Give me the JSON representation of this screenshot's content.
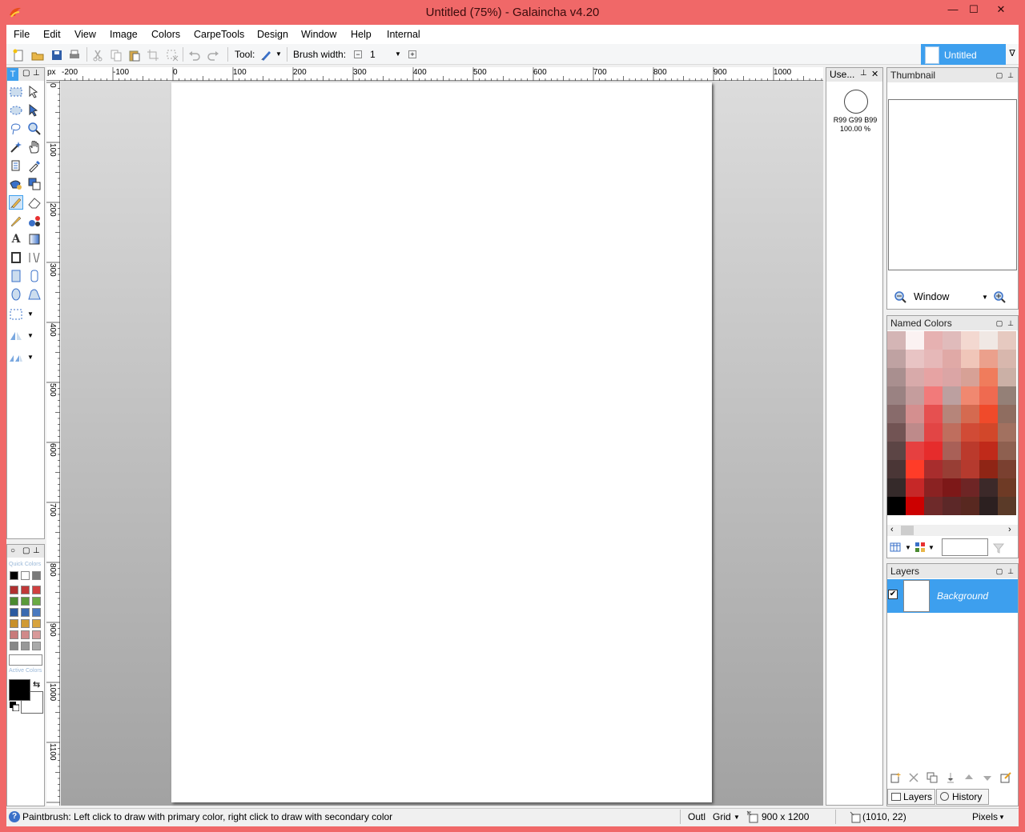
{
  "window": {
    "title": "Untitled (75%) - Galaincha v4.20",
    "minimize": "—",
    "maximize": "☐",
    "close": "✕"
  },
  "menubar": {
    "items": [
      "File",
      "Edit",
      "View",
      "Image",
      "Colors",
      "CarpeTools",
      "Design",
      "Window",
      "Help",
      "Internal"
    ]
  },
  "toolbar": {
    "tool_label": "Tool:",
    "brush_label": "Brush width:",
    "brush_value": "1",
    "minus": "−",
    "plus": "+"
  },
  "document_tab": {
    "label": "Untitled",
    "dropdown": "∇"
  },
  "toolbox": {
    "header": "T"
  },
  "rulers": {
    "unit": "px",
    "top_labels": [
      "-200",
      "-100",
      "0",
      "100",
      "200",
      "300",
      "400",
      "500",
      "600",
      "700",
      "800",
      "900",
      "1000"
    ],
    "left_labels": [
      "0",
      "100",
      "200",
      "300",
      "400",
      "500",
      "600",
      "700",
      "800",
      "900",
      "1000",
      "1100"
    ]
  },
  "used_colors": {
    "title": "Use...",
    "rgb": "R99 G99 B99",
    "percent": "100.00 %"
  },
  "thumbnail": {
    "title": "Thumbnail",
    "zoom_mode": "Window"
  },
  "named_colors": {
    "title": "Named Colors",
    "grid": [
      [
        "#d4b5b5",
        "#fbf2f2",
        "#e6b1b1",
        "#e0bbbb",
        "#f3d8d0",
        "#f0e8e4",
        "#e6c9c0"
      ],
      [
        "#bfa2a2",
        "#e8c4c4",
        "#e6b8b8",
        "#e0a9a6",
        "#f0c6b9",
        "#eba08c",
        "#d8b7ad"
      ],
      [
        "#a98f8f",
        "#d8aaaa",
        "#e6a3a3",
        "#dba5a5",
        "#d7a196",
        "#f07c5c",
        "#cbb0a6"
      ],
      [
        "#9a8282",
        "#c59d9d",
        "#f27a7a",
        "#bca0a0",
        "#f08870",
        "#ef6a50",
        "#948077"
      ],
      [
        "#886b6b",
        "#d48f8f",
        "#e65050",
        "#b6857a",
        "#d56a50",
        "#f04a2a",
        "#8f6d60"
      ],
      [
        "#725454",
        "#be8a8a",
        "#e24545",
        "#bf6e5e",
        "#d14b36",
        "#d2472a",
        "#a27160"
      ],
      [
        "#5c4545",
        "#e64040",
        "#e62c2c",
        "#a96057",
        "#bb3a2c",
        "#c02a1a",
        "#8e6050"
      ],
      [
        "#4a3636",
        "#ff3c28",
        "#a82d2d",
        "#983e35",
        "#b53a2e",
        "#8f2515",
        "#7a4030"
      ],
      [
        "#352a2a",
        "#c62828",
        "#8a2222",
        "#7d1818",
        "#6e2525",
        "#3c2929",
        "#6e3a25"
      ],
      [
        "#000000",
        "#cc0000",
        "#6e2a2a",
        "#5c2828",
        "#582820",
        "#2c2020",
        "#5a3a28"
      ]
    ]
  },
  "layers": {
    "title": "Layers",
    "items": [
      {
        "name": "Background",
        "checked": "✔"
      }
    ],
    "tabs": [
      "Layers",
      "History"
    ]
  },
  "statusbar": {
    "hint": "Paintbrush: Left click to draw with primary color, right click to draw with secondary color",
    "outline": "Outl",
    "grid": "Grid",
    "size": "900 x 1200",
    "position": "(1010, 22)",
    "units": "Pixels"
  },
  "colors": {
    "accent": "#3d9fee",
    "frame": "#f06868",
    "primary": "#000000",
    "secondary": "#ffffff"
  },
  "quick_colors": {
    "label": "Quick Colors",
    "active_label": "Active Colors",
    "rows": [
      [
        "#000000",
        "#ffffff",
        "#7a7a7a"
      ],
      [
        "#b03030",
        "#c03838",
        "#d04040"
      ],
      [
        "#4a8a30",
        "#5a9a3a",
        "#6aaa44"
      ],
      [
        "#2a5aa0",
        "#3a6ab0",
        "#4a7ac0"
      ],
      [
        "#c8902a",
        "#d09a34",
        "#d8a43e"
      ],
      [
        "#c87a7a",
        "#d08a8a",
        "#d89a9a"
      ],
      [
        "#888888",
        "#999999",
        "#aaaaaa"
      ]
    ]
  }
}
